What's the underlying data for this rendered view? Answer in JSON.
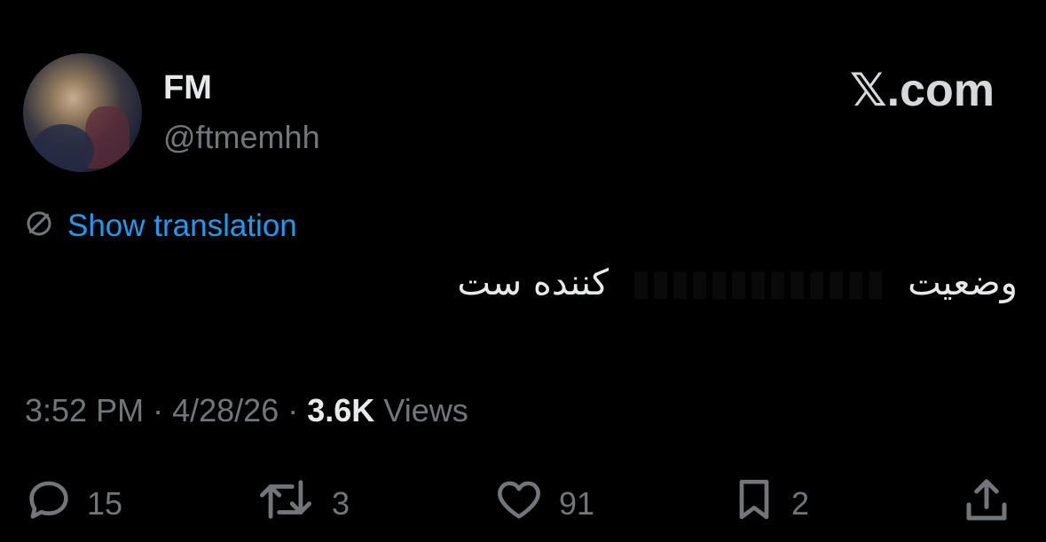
{
  "author": {
    "display_name": "FM",
    "handle": "@ftmemhh"
  },
  "watermark": "𝕏.com",
  "translate_label": "Show translation",
  "tweet": {
    "text_start": "وضعیت",
    "text_end": "کننده ست"
  },
  "meta": {
    "time": "3:52 PM",
    "date": "4/28/26",
    "separator": "·",
    "views_count": "3.6K",
    "views_label": "Views"
  },
  "actions": {
    "replies": "15",
    "reposts": "3",
    "likes": "91",
    "bookmarks": "2"
  },
  "colors": {
    "background": "#000000",
    "primary_text": "#e7e9ea",
    "secondary_text": "#71767b",
    "link": "#1d9bf0"
  },
  "icons": [
    "reply-icon",
    "repost-icon",
    "like-icon",
    "bookmark-icon",
    "share-icon",
    "globe-icon"
  ]
}
